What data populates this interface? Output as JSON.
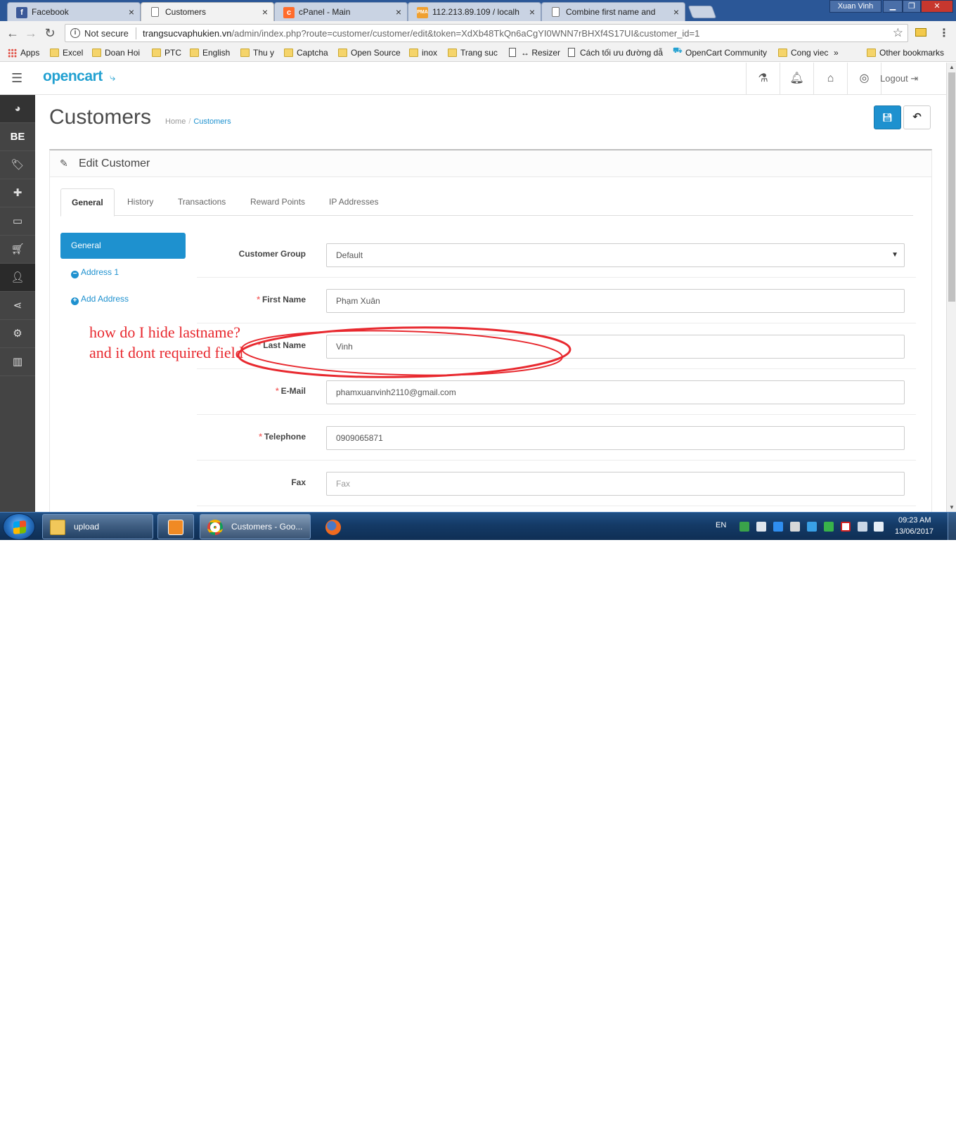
{
  "browser": {
    "tabs": [
      {
        "title": "Facebook",
        "favicon": "facebook-icon"
      },
      {
        "title": "Customers",
        "favicon": "page-icon"
      },
      {
        "title": "cPanel - Main",
        "favicon": "cpanel-icon"
      },
      {
        "title": "112.213.89.109 / localho",
        "favicon": "phpmyadmin-icon"
      },
      {
        "title": "Combine first name and",
        "favicon": "page-icon"
      }
    ],
    "active_tab": 1,
    "user": "Xuan Vinh",
    "security": "Not secure",
    "url_host": "trangsucvaphukien.vn",
    "url_path": "/admin/index.php?route=customer/customer/edit&token=XdXb48TkQn6aCgYI0WNN7rBHXf4S17UI&customer_id=1"
  },
  "bookmarks": [
    {
      "label": "Apps",
      "type": "apps"
    },
    {
      "label": "Excel",
      "type": "folder"
    },
    {
      "label": "Doan Hoi",
      "type": "folder"
    },
    {
      "label": "PTC",
      "type": "folder"
    },
    {
      "label": "English",
      "type": "folder"
    },
    {
      "label": "Thu y",
      "type": "folder"
    },
    {
      "label": "Captcha",
      "type": "folder"
    },
    {
      "label": "Open Source",
      "type": "folder"
    },
    {
      "label": "inox",
      "type": "folder"
    },
    {
      "label": "Trang suc",
      "type": "folder"
    },
    {
      "label": "↔ Resizer",
      "type": "page"
    },
    {
      "label": "Cách tối ưu đường dẫ",
      "type": "page"
    },
    {
      "label": "OpenCart Community",
      "type": "opencart"
    },
    {
      "label": "Cong viec",
      "type": "folder"
    },
    {
      "label": "»",
      "type": "more"
    },
    {
      "label": "Other bookmarks",
      "type": "folder"
    }
  ],
  "header": {
    "logo": "opencart",
    "logout": "Logout"
  },
  "sidebar": {
    "store_label": "BE",
    "items": [
      "dashboard-icon",
      "catalog-icon",
      "extensions-icon",
      "design-icon",
      "sales-icon",
      "customers-icon",
      "marketing-icon",
      "system-icon",
      "reports-icon"
    ]
  },
  "page": {
    "title": "Customers",
    "breadcrumb": [
      "Home",
      "Customers"
    ],
    "panel_title": "Edit Customer",
    "tabs": [
      "General",
      "History",
      "Transactions",
      "Reward Points",
      "IP Addresses"
    ],
    "vertical_tabs": {
      "general": "General",
      "address1": "Address 1",
      "add_address": "Add Address"
    },
    "form": {
      "customer_group": {
        "label": "Customer Group",
        "value": "Default",
        "required": false
      },
      "firstname": {
        "label": "First Name",
        "value": "Phạm Xuân",
        "required": true
      },
      "lastname": {
        "label": "Last Name",
        "value": "Vinh",
        "required": true
      },
      "email": {
        "label": "E-Mail",
        "value": "phamxuanvinh2110@gmail.com",
        "required": true
      },
      "telephone": {
        "label": "Telephone",
        "value": "0909065871",
        "required": true
      },
      "fax": {
        "label": "Fax",
        "value": "",
        "placeholder": "Fax",
        "required": false
      }
    }
  },
  "annotation": {
    "line1": "how do I hide lastname?",
    "line2": "and it dont required field",
    "color": "#e8292f"
  },
  "taskbar": {
    "buttons": [
      "upload",
      "Customers - Goo..."
    ],
    "language": "EN",
    "time": "09:23 AM",
    "date": "13/06/2017"
  }
}
